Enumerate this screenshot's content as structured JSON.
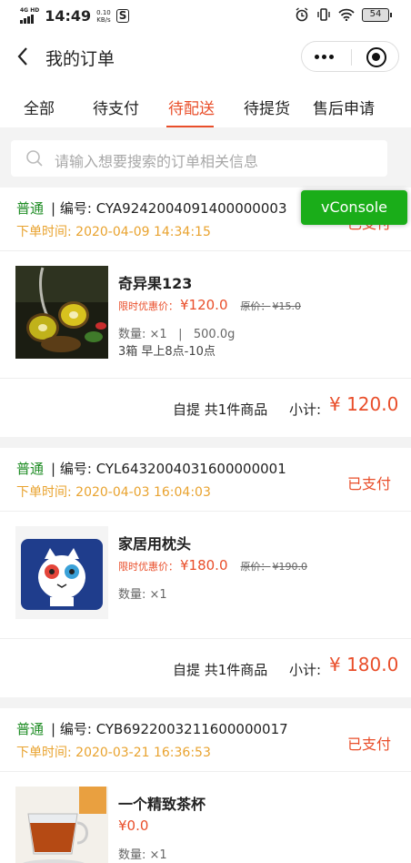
{
  "status_bar": {
    "network": "4G HD",
    "time": "14:49",
    "speed_value": "0.10",
    "speed_unit": "KB/s",
    "app_badge": "S",
    "battery": "54"
  },
  "nav": {
    "title": "我的订单"
  },
  "tabs": [
    {
      "label": "全部",
      "active": false
    },
    {
      "label": "待支付",
      "active": false
    },
    {
      "label": "待配送",
      "active": true
    },
    {
      "label": "待提货",
      "active": false
    },
    {
      "label": "售后申请",
      "active": false
    }
  ],
  "search": {
    "placeholder": "请输入想要搜索的订单相关信息"
  },
  "vconsole": {
    "label": "vConsole"
  },
  "labels": {
    "separator": "|",
    "order_no_prefix": "编号:",
    "time_prefix": "下单时间:",
    "promo_label": "限时优惠价：",
    "original_label": "原价：",
    "subtotal_label": "小计:"
  },
  "orders": [
    {
      "type": "普通",
      "order_no": "CYA9242004091400000003",
      "time": "2020-04-09 14:34:15",
      "status": "已支付",
      "goods_name": "奇异果123",
      "promo_price": "¥120.0",
      "original_price": "¥15.0",
      "quantity": "数量: ×1",
      "spec": "500.0g",
      "slot": "3箱 早上8点-10点",
      "delivery": "自提 共1件商品",
      "subtotal": "¥ 120.0"
    },
    {
      "type": "普通",
      "order_no": "CYL6432004031600000001",
      "time": "2020-04-03 16:04:03",
      "status": "已支付",
      "goods_name": "家居用枕头",
      "promo_price": "¥180.0",
      "original_price": "¥190.0",
      "quantity": "数量: ×1",
      "delivery": "自提 共1件商品",
      "subtotal": "¥ 180.0"
    },
    {
      "type": "普通",
      "order_no": "CYB6922003211600000017",
      "time": "2020-03-21 16:36:53",
      "status": "已支付",
      "goods_name": "一个精致茶杯",
      "price": "¥0.0",
      "quantity": "数量: ×1"
    }
  ],
  "colors": {
    "accent": "#e94e2a",
    "type_green": "#1e8c24",
    "time_orange": "#e9a32f",
    "vconsole_green": "#1aad19"
  }
}
